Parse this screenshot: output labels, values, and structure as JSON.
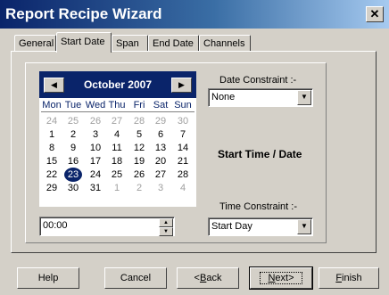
{
  "window": {
    "title": "Report Recipe Wizard",
    "close_glyph": "✕"
  },
  "tabs": [
    {
      "label": "General"
    },
    {
      "label": "Start Date"
    },
    {
      "label": "Span"
    },
    {
      "label": "End Date"
    },
    {
      "label": "Channels"
    }
  ],
  "active_tab": "Start Date",
  "calendar": {
    "month_label": "October 2007",
    "prev_glyph": "◀",
    "next_glyph": "▶",
    "days_of_week": [
      "Mon",
      "Tue",
      "Wed",
      "Thu",
      "Fri",
      "Sat",
      "Sun"
    ],
    "weeks": [
      [
        "24",
        "25",
        "26",
        "27",
        "28",
        "29",
        "30"
      ],
      [
        "1",
        "2",
        "3",
        "4",
        "5",
        "6",
        "7"
      ],
      [
        "8",
        "9",
        "10",
        "11",
        "12",
        "13",
        "14"
      ],
      [
        "15",
        "16",
        "17",
        "18",
        "19",
        "20",
        "21"
      ],
      [
        "22",
        "23",
        "24",
        "25",
        "26",
        "27",
        "28"
      ],
      [
        "29",
        "30",
        "31",
        "1",
        "2",
        "3",
        "4"
      ]
    ],
    "selected_day": "23",
    "colors": {
      "header": "#0a246a",
      "muted": "#a0a0a0"
    }
  },
  "date_constraint": {
    "label": "Date Constraint :-",
    "value": "None"
  },
  "section_title": "Start Time / Date",
  "time_constraint": {
    "label": "Time Constraint :-",
    "value": "Start Day"
  },
  "time_field": {
    "value": "00:00"
  },
  "buttons": {
    "help": "Help",
    "cancel": "Cancel",
    "back_prefix": "<",
    "back_mnemonic": "B",
    "back_rest": "ack",
    "next_mnemonic": "N",
    "next_rest": "ext>",
    "finish_mnemonic": "F",
    "finish_rest": "inish"
  },
  "icons": {
    "dropdown": "▼",
    "spin_up": "▲",
    "spin_down": "▼"
  }
}
